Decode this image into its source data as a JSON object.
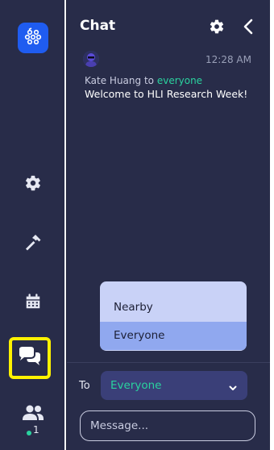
{
  "chat": {
    "title": "Chat",
    "message": {
      "author": "Kate Huang",
      "to_word": "to",
      "recipient": "everyone",
      "time": "12:28 AM",
      "text": "Welcome to HLI Research Week!"
    },
    "dropdown": {
      "options": [
        "Nearby",
        "Everyone"
      ],
      "highlighted": "Everyone"
    },
    "composer": {
      "to_label": "To",
      "selected": "Everyone",
      "placeholder": "Message..."
    }
  },
  "rail": {
    "online_count": "1"
  },
  "colors": {
    "background": "#282c49",
    "accent_blue": "#1f5cf0",
    "accent_green": "#2ad39f",
    "highlight_yellow": "#fff200",
    "dropdown_bg": "#c9d2f7",
    "dropdown_selected": "#90a8ef"
  },
  "icons": [
    "logo-icon",
    "settings-gear-icon",
    "hammer-icon",
    "calendar-icon",
    "chat-bubbles-icon",
    "people-icon",
    "chat-settings-gear-icon",
    "chevron-left-icon",
    "chevron-down-icon",
    "avatar"
  ]
}
